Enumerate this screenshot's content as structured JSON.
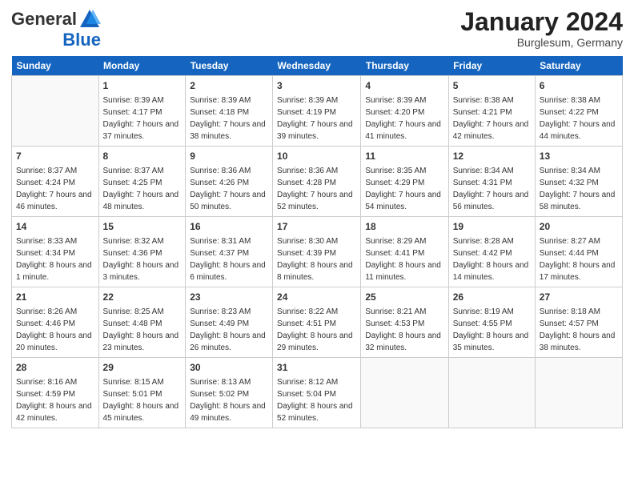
{
  "header": {
    "logo_general": "General",
    "logo_blue": "Blue",
    "month_title": "January 2024",
    "location": "Burglesum, Germany"
  },
  "columns": [
    "Sunday",
    "Monday",
    "Tuesday",
    "Wednesday",
    "Thursday",
    "Friday",
    "Saturday"
  ],
  "weeks": [
    [
      {
        "num": "",
        "sunrise": "",
        "sunset": "",
        "daylight": ""
      },
      {
        "num": "1",
        "sunrise": "Sunrise: 8:39 AM",
        "sunset": "Sunset: 4:17 PM",
        "daylight": "Daylight: 7 hours and 37 minutes."
      },
      {
        "num": "2",
        "sunrise": "Sunrise: 8:39 AM",
        "sunset": "Sunset: 4:18 PM",
        "daylight": "Daylight: 7 hours and 38 minutes."
      },
      {
        "num": "3",
        "sunrise": "Sunrise: 8:39 AM",
        "sunset": "Sunset: 4:19 PM",
        "daylight": "Daylight: 7 hours and 39 minutes."
      },
      {
        "num": "4",
        "sunrise": "Sunrise: 8:39 AM",
        "sunset": "Sunset: 4:20 PM",
        "daylight": "Daylight: 7 hours and 41 minutes."
      },
      {
        "num": "5",
        "sunrise": "Sunrise: 8:38 AM",
        "sunset": "Sunset: 4:21 PM",
        "daylight": "Daylight: 7 hours and 42 minutes."
      },
      {
        "num": "6",
        "sunrise": "Sunrise: 8:38 AM",
        "sunset": "Sunset: 4:22 PM",
        "daylight": "Daylight: 7 hours and 44 minutes."
      }
    ],
    [
      {
        "num": "7",
        "sunrise": "Sunrise: 8:37 AM",
        "sunset": "Sunset: 4:24 PM",
        "daylight": "Daylight: 7 hours and 46 minutes."
      },
      {
        "num": "8",
        "sunrise": "Sunrise: 8:37 AM",
        "sunset": "Sunset: 4:25 PM",
        "daylight": "Daylight: 7 hours and 48 minutes."
      },
      {
        "num": "9",
        "sunrise": "Sunrise: 8:36 AM",
        "sunset": "Sunset: 4:26 PM",
        "daylight": "Daylight: 7 hours and 50 minutes."
      },
      {
        "num": "10",
        "sunrise": "Sunrise: 8:36 AM",
        "sunset": "Sunset: 4:28 PM",
        "daylight": "Daylight: 7 hours and 52 minutes."
      },
      {
        "num": "11",
        "sunrise": "Sunrise: 8:35 AM",
        "sunset": "Sunset: 4:29 PM",
        "daylight": "Daylight: 7 hours and 54 minutes."
      },
      {
        "num": "12",
        "sunrise": "Sunrise: 8:34 AM",
        "sunset": "Sunset: 4:31 PM",
        "daylight": "Daylight: 7 hours and 56 minutes."
      },
      {
        "num": "13",
        "sunrise": "Sunrise: 8:34 AM",
        "sunset": "Sunset: 4:32 PM",
        "daylight": "Daylight: 7 hours and 58 minutes."
      }
    ],
    [
      {
        "num": "14",
        "sunrise": "Sunrise: 8:33 AM",
        "sunset": "Sunset: 4:34 PM",
        "daylight": "Daylight: 8 hours and 1 minute."
      },
      {
        "num": "15",
        "sunrise": "Sunrise: 8:32 AM",
        "sunset": "Sunset: 4:36 PM",
        "daylight": "Daylight: 8 hours and 3 minutes."
      },
      {
        "num": "16",
        "sunrise": "Sunrise: 8:31 AM",
        "sunset": "Sunset: 4:37 PM",
        "daylight": "Daylight: 8 hours and 6 minutes."
      },
      {
        "num": "17",
        "sunrise": "Sunrise: 8:30 AM",
        "sunset": "Sunset: 4:39 PM",
        "daylight": "Daylight: 8 hours and 8 minutes."
      },
      {
        "num": "18",
        "sunrise": "Sunrise: 8:29 AM",
        "sunset": "Sunset: 4:41 PM",
        "daylight": "Daylight: 8 hours and 11 minutes."
      },
      {
        "num": "19",
        "sunrise": "Sunrise: 8:28 AM",
        "sunset": "Sunset: 4:42 PM",
        "daylight": "Daylight: 8 hours and 14 minutes."
      },
      {
        "num": "20",
        "sunrise": "Sunrise: 8:27 AM",
        "sunset": "Sunset: 4:44 PM",
        "daylight": "Daylight: 8 hours and 17 minutes."
      }
    ],
    [
      {
        "num": "21",
        "sunrise": "Sunrise: 8:26 AM",
        "sunset": "Sunset: 4:46 PM",
        "daylight": "Daylight: 8 hours and 20 minutes."
      },
      {
        "num": "22",
        "sunrise": "Sunrise: 8:25 AM",
        "sunset": "Sunset: 4:48 PM",
        "daylight": "Daylight: 8 hours and 23 minutes."
      },
      {
        "num": "23",
        "sunrise": "Sunrise: 8:23 AM",
        "sunset": "Sunset: 4:49 PM",
        "daylight": "Daylight: 8 hours and 26 minutes."
      },
      {
        "num": "24",
        "sunrise": "Sunrise: 8:22 AM",
        "sunset": "Sunset: 4:51 PM",
        "daylight": "Daylight: 8 hours and 29 minutes."
      },
      {
        "num": "25",
        "sunrise": "Sunrise: 8:21 AM",
        "sunset": "Sunset: 4:53 PM",
        "daylight": "Daylight: 8 hours and 32 minutes."
      },
      {
        "num": "26",
        "sunrise": "Sunrise: 8:19 AM",
        "sunset": "Sunset: 4:55 PM",
        "daylight": "Daylight: 8 hours and 35 minutes."
      },
      {
        "num": "27",
        "sunrise": "Sunrise: 8:18 AM",
        "sunset": "Sunset: 4:57 PM",
        "daylight": "Daylight: 8 hours and 38 minutes."
      }
    ],
    [
      {
        "num": "28",
        "sunrise": "Sunrise: 8:16 AM",
        "sunset": "Sunset: 4:59 PM",
        "daylight": "Daylight: 8 hours and 42 minutes."
      },
      {
        "num": "29",
        "sunrise": "Sunrise: 8:15 AM",
        "sunset": "Sunset: 5:01 PM",
        "daylight": "Daylight: 8 hours and 45 minutes."
      },
      {
        "num": "30",
        "sunrise": "Sunrise: 8:13 AM",
        "sunset": "Sunset: 5:02 PM",
        "daylight": "Daylight: 8 hours and 49 minutes."
      },
      {
        "num": "31",
        "sunrise": "Sunrise: 8:12 AM",
        "sunset": "Sunset: 5:04 PM",
        "daylight": "Daylight: 8 hours and 52 minutes."
      },
      {
        "num": "",
        "sunrise": "",
        "sunset": "",
        "daylight": ""
      },
      {
        "num": "",
        "sunrise": "",
        "sunset": "",
        "daylight": ""
      },
      {
        "num": "",
        "sunrise": "",
        "sunset": "",
        "daylight": ""
      }
    ]
  ]
}
